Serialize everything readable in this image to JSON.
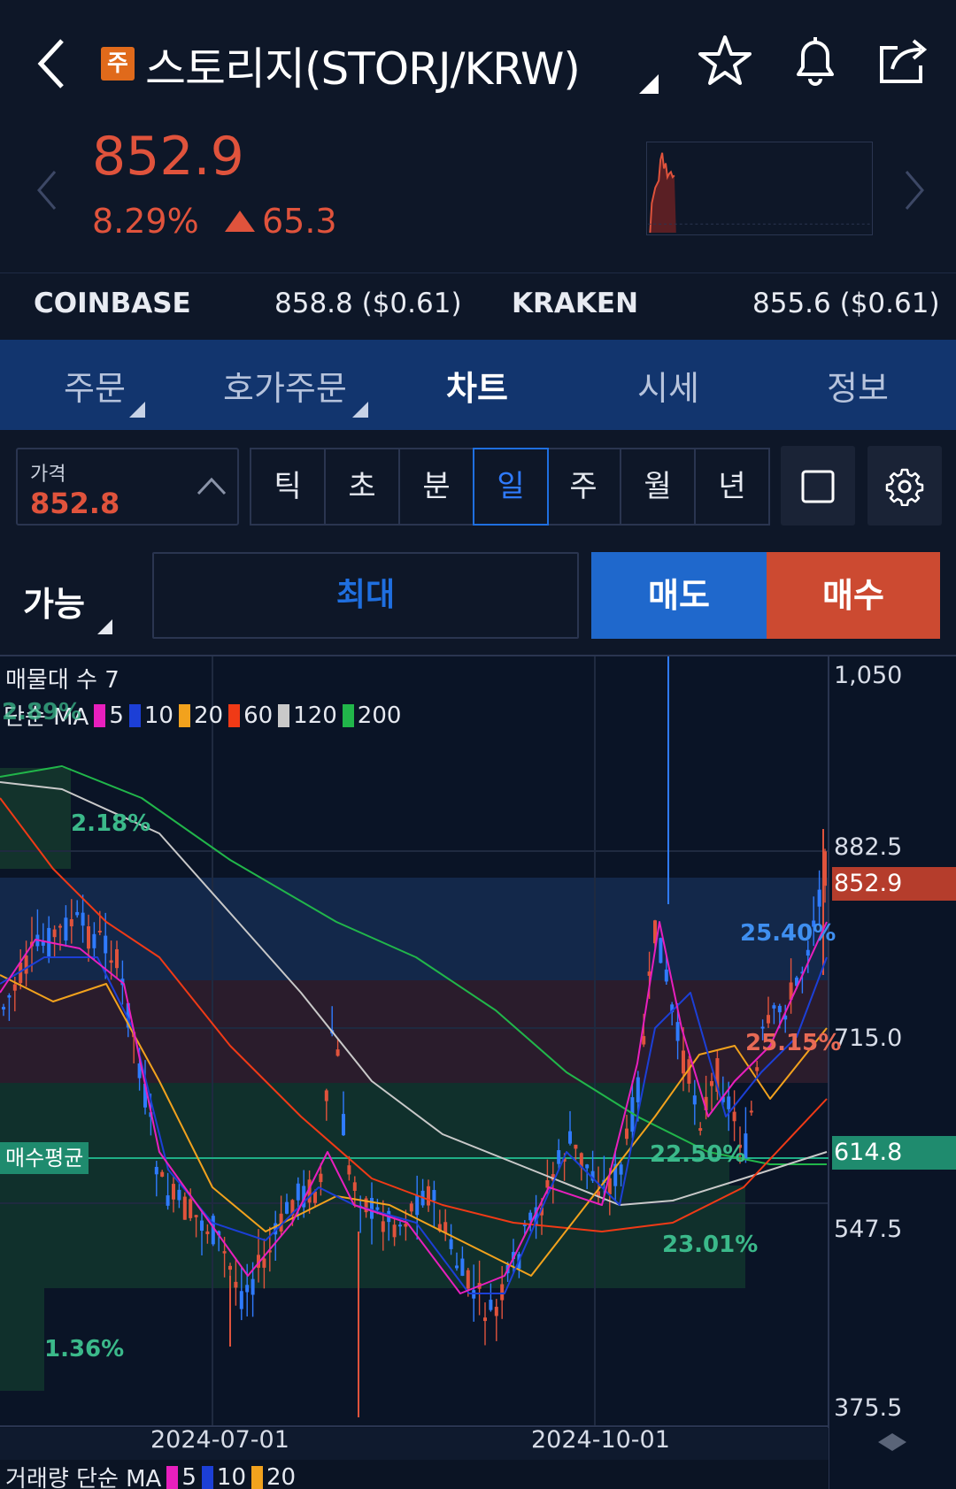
{
  "header": {
    "badge": "주",
    "title": "스토리지(STORJ/KRW)"
  },
  "price": {
    "current": "852.9",
    "change_pct": "8.29%",
    "change_abs": "65.3"
  },
  "exchanges": [
    {
      "name": "COINBASE",
      "value": "858.8 ($0.61)"
    },
    {
      "name": "KRAKEN",
      "value": "855.6 ($0.61)"
    }
  ],
  "tabs": [
    "주문",
    "호가주문",
    "차트",
    "시세",
    "정보"
  ],
  "toolbar": {
    "price_label": "가격",
    "price_value": "852.8",
    "periods": [
      "틱",
      "초",
      "분",
      "일",
      "주",
      "월",
      "년"
    ],
    "selected_period": "일"
  },
  "order": {
    "avail": "가능",
    "max": "최대",
    "sell": "매도",
    "buy": "매수"
  },
  "chart": {
    "volume_profile_label": "매물대 수 7",
    "ma_label": "단순 MA",
    "ma_periods": [
      {
        "p": "5",
        "color": "#e81fbd"
      },
      {
        "p": "10",
        "color": "#1c3fd6"
      },
      {
        "p": "20",
        "color": "#f2a21d"
      },
      {
        "p": "60",
        "color": "#f03a16"
      },
      {
        "p": "120",
        "color": "#c9c9c9"
      },
      {
        "p": "200",
        "color": "#21b64a"
      }
    ],
    "ma_overlap_text": "2.89%",
    "y_ticks": [
      "1,050",
      "882.5",
      "715.0",
      "547.5",
      "375.5"
    ],
    "last_price_tag": "852.9",
    "avg_tag": "614.8",
    "avg_label": "매수평균",
    "x_ticks": [
      "2024-07-01",
      "2024-10-01"
    ],
    "profile_pcts": [
      {
        "text": "2.18%",
        "color": "#3bb98a"
      },
      {
        "text": "25.40%",
        "color": "#3f8ff0"
      },
      {
        "text": "25.15%",
        "color": "#e86a55"
      },
      {
        "text": "22.50%",
        "color": "#3bb98a"
      },
      {
        "text": "23.01%",
        "color": "#3bb98a"
      },
      {
        "text": "1.36%",
        "color": "#3bb98a"
      }
    ],
    "volume_ma_label": "거래량 단순 MA",
    "volume_ma_periods": [
      {
        "p": "5",
        "color": "#e81fbd"
      },
      {
        "p": "10",
        "color": "#1c3fd6"
      },
      {
        "p": "20",
        "color": "#f2a21d"
      }
    ]
  }
}
